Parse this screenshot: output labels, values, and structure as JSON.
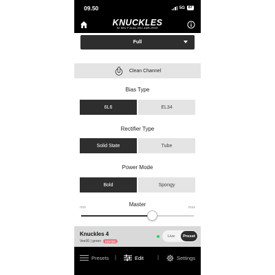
{
  "status": {
    "time": "09.50",
    "network": "5G",
    "battery": "87"
  },
  "header": {
    "logo_main": "KNUCKLES",
    "logo_sub": "92 REV F DUAL REC AMPLIFIER"
  },
  "preset_select": {
    "value": "Full"
  },
  "clean_channel": {
    "label": "Clean Channel"
  },
  "bias_type": {
    "title": "Bias Type",
    "options": [
      "6L6",
      "EL34"
    ],
    "selected": "6L6"
  },
  "rectifier_type": {
    "title": "Rectifier Type",
    "options": [
      "Solid State",
      "Tube"
    ],
    "selected": "Solid State"
  },
  "power_mode": {
    "title": "Power Mode",
    "options": [
      "Bold",
      "Spongy"
    ],
    "selected": "Bold"
  },
  "master": {
    "title": "Master",
    "min_label": "min",
    "max_label": "max",
    "value_fraction": 0.63
  },
  "preset_bar": {
    "name": "Knuckles 4",
    "sub": "Vee30 | green",
    "badge": "EDITED",
    "mode_live": "Live",
    "mode_preset": "Preset"
  },
  "nav": {
    "presets": "Presets",
    "edit": "Edit",
    "settings": "Settings",
    "separator": "|"
  },
  "colors": {
    "dark": "#2e2e2e",
    "light": "#e4e4e4",
    "badge": "#e9707a",
    "live_dot": "#2ecc5f"
  }
}
